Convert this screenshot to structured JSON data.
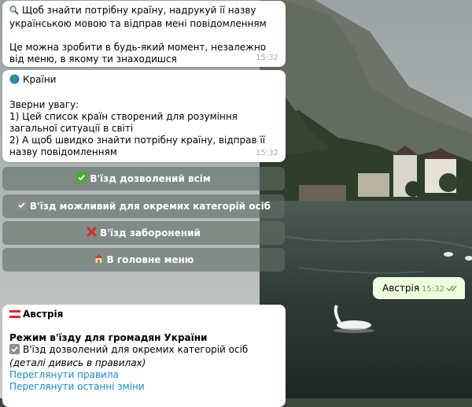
{
  "messages": {
    "m1": {
      "line1": "Щоб знайти потрібну країну, надрукуй її назву українською мовою та відправ мені повідомленням",
      "line2": "Це можна зробити в будь-який момент, незалежно від меню, в якому ти знаходишся",
      "time": "15:32"
    },
    "m2": {
      "title": "Країни",
      "body": "Зверни увагу:\n1) Цей список країн створений для розуміння загальної ситуації в світі\n2) А щоб швидко знайти потрібну країну, відправ її назву повідомленням",
      "time": "15:32"
    },
    "out": {
      "text": "Австрія",
      "time": "15:32"
    },
    "m3": {
      "title": "Австрія",
      "regime_heading": "Режим в'їзду для громадян України",
      "status": "В'їзд дозволений для окремих категорій осіб",
      "status_note": "(деталі дивись в правилах)",
      "link_rules": "Переглянути правила",
      "link_changes": "Переглянути останні зміни"
    }
  },
  "keyboard": {
    "b1": "В'їзд дозволений всім",
    "b2": "В'їзд можливий для окремих категорій осіб",
    "b3": "В'їзд заборонений",
    "b4": "В головне меню"
  },
  "colors": {
    "bubble": "#ffffff",
    "outgoing": "#effdde",
    "link": "#168acd",
    "time": "#a0acb6"
  },
  "icons": [
    "magnifier-icon",
    "globe-icon",
    "green-check-icon",
    "grey-check-icon",
    "red-cross-icon",
    "house-icon",
    "austria-flag-icon",
    "double-check-icon"
  ]
}
